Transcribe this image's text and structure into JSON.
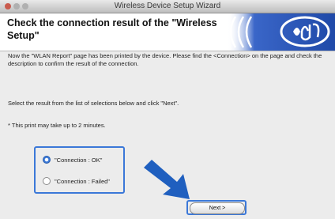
{
  "window": {
    "title": "Wireless Device Setup Wizard"
  },
  "header": {
    "title": "Check the connection result of the \"Wireless Setup\""
  },
  "content": {
    "instruction": "Now the \"WLAN Report\" page has been printed by the device. Please find the <Connection> on the page and check the description to confirm the result of the connection.",
    "select_prompt": "Select the result from the list of selections below and click \"Next\".",
    "note": "* This print may take up to 2 minutes."
  },
  "options": [
    {
      "label": "\"Connection : OK\"",
      "selected": true
    },
    {
      "label": "\"Connection : Failed\"",
      "selected": false
    }
  ],
  "buttons": {
    "next": "Next >"
  },
  "colors": {
    "highlight": "#3b78d8",
    "arrow": "#1f5fbf",
    "logo_blue": "#2a56b8"
  }
}
